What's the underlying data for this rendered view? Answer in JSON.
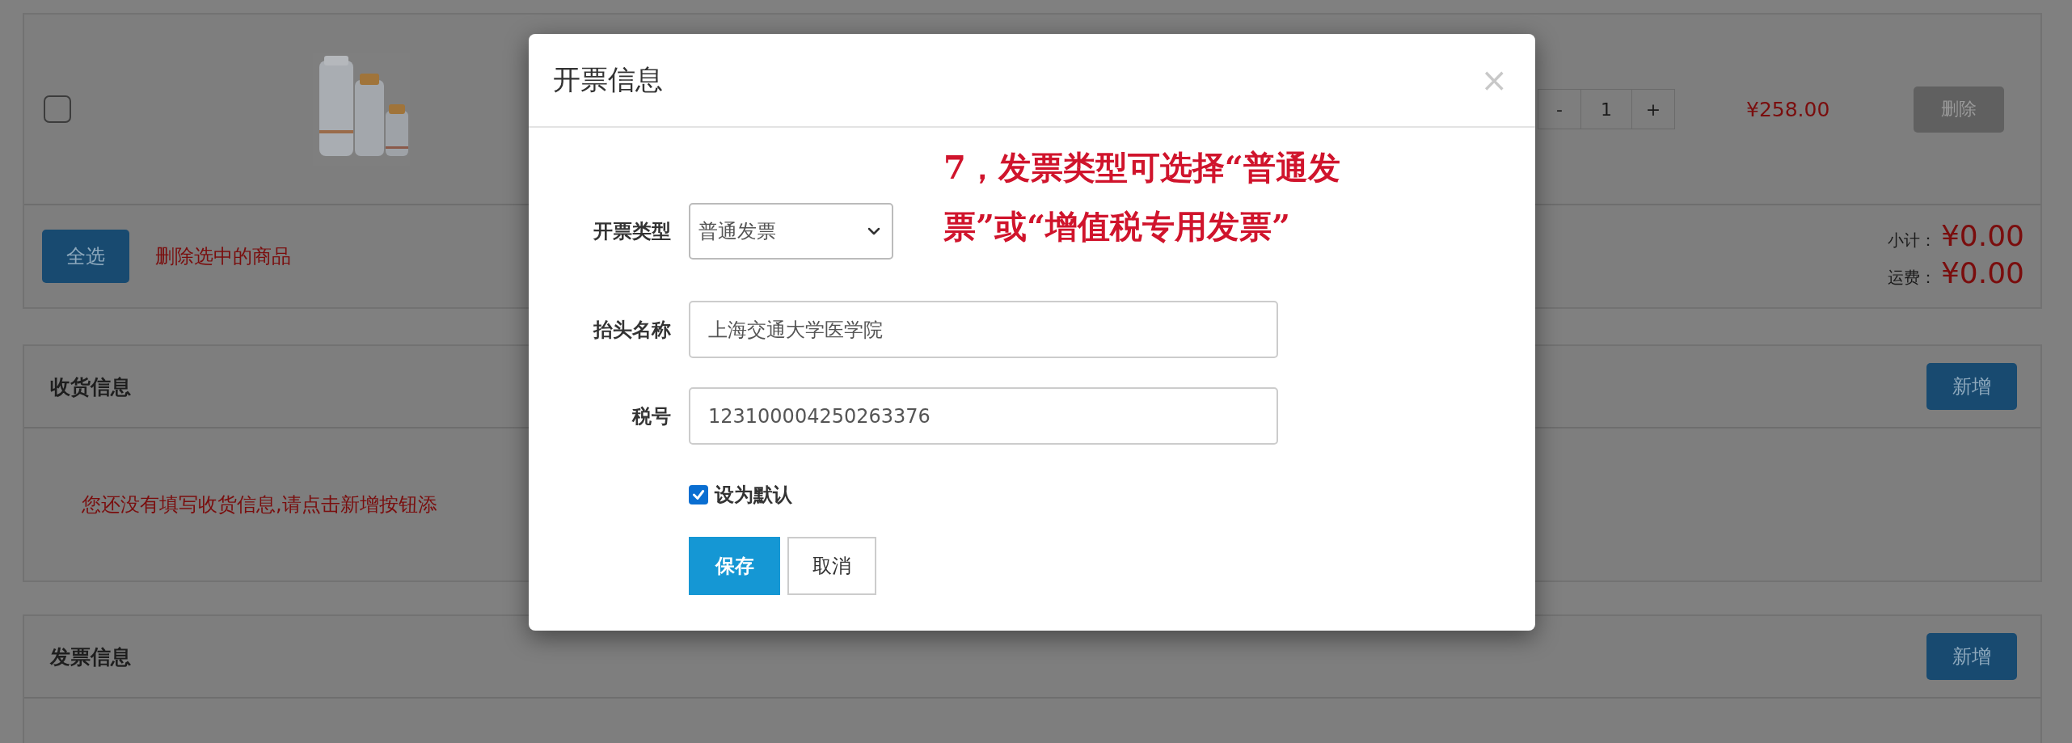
{
  "cart": {
    "items": [
      {
        "checked": false,
        "quantity": {
          "minus": "-",
          "value": "1",
          "plus": "+"
        },
        "price": "¥258.00",
        "delete_button": "删除"
      }
    ],
    "select_all_button": "全选",
    "delete_selected_link": "删除选中的商品",
    "subtotal": {
      "label": "小计：",
      "value": "¥0.00"
    },
    "shipping": {
      "label": "运费：",
      "value": "¥0.00"
    }
  },
  "sections": [
    {
      "title": "收货信息",
      "add_button": "新增",
      "message": "您还没有填写收货信息,请点击新增按钮添"
    },
    {
      "title": "发票信息",
      "add_button": "新增"
    }
  ],
  "modal": {
    "title": "开票信息",
    "close": "×",
    "fields": [
      {
        "kind": "select",
        "label": "开票类型",
        "value": "普通发票"
      },
      {
        "kind": "text",
        "label": "抬头名称",
        "value": "上海交通大学医学院"
      },
      {
        "kind": "text",
        "label": "税号",
        "value": "123100004250263376"
      }
    ],
    "default_checkbox": {
      "label": "设为默认",
      "checked": true
    },
    "buttons": [
      {
        "label": "保存",
        "kind": "primary"
      },
      {
        "label": "取消",
        "kind": "default"
      }
    ]
  },
  "annotation": "7，发票类型可选择“普通发票”或“增值税专用发票”"
}
